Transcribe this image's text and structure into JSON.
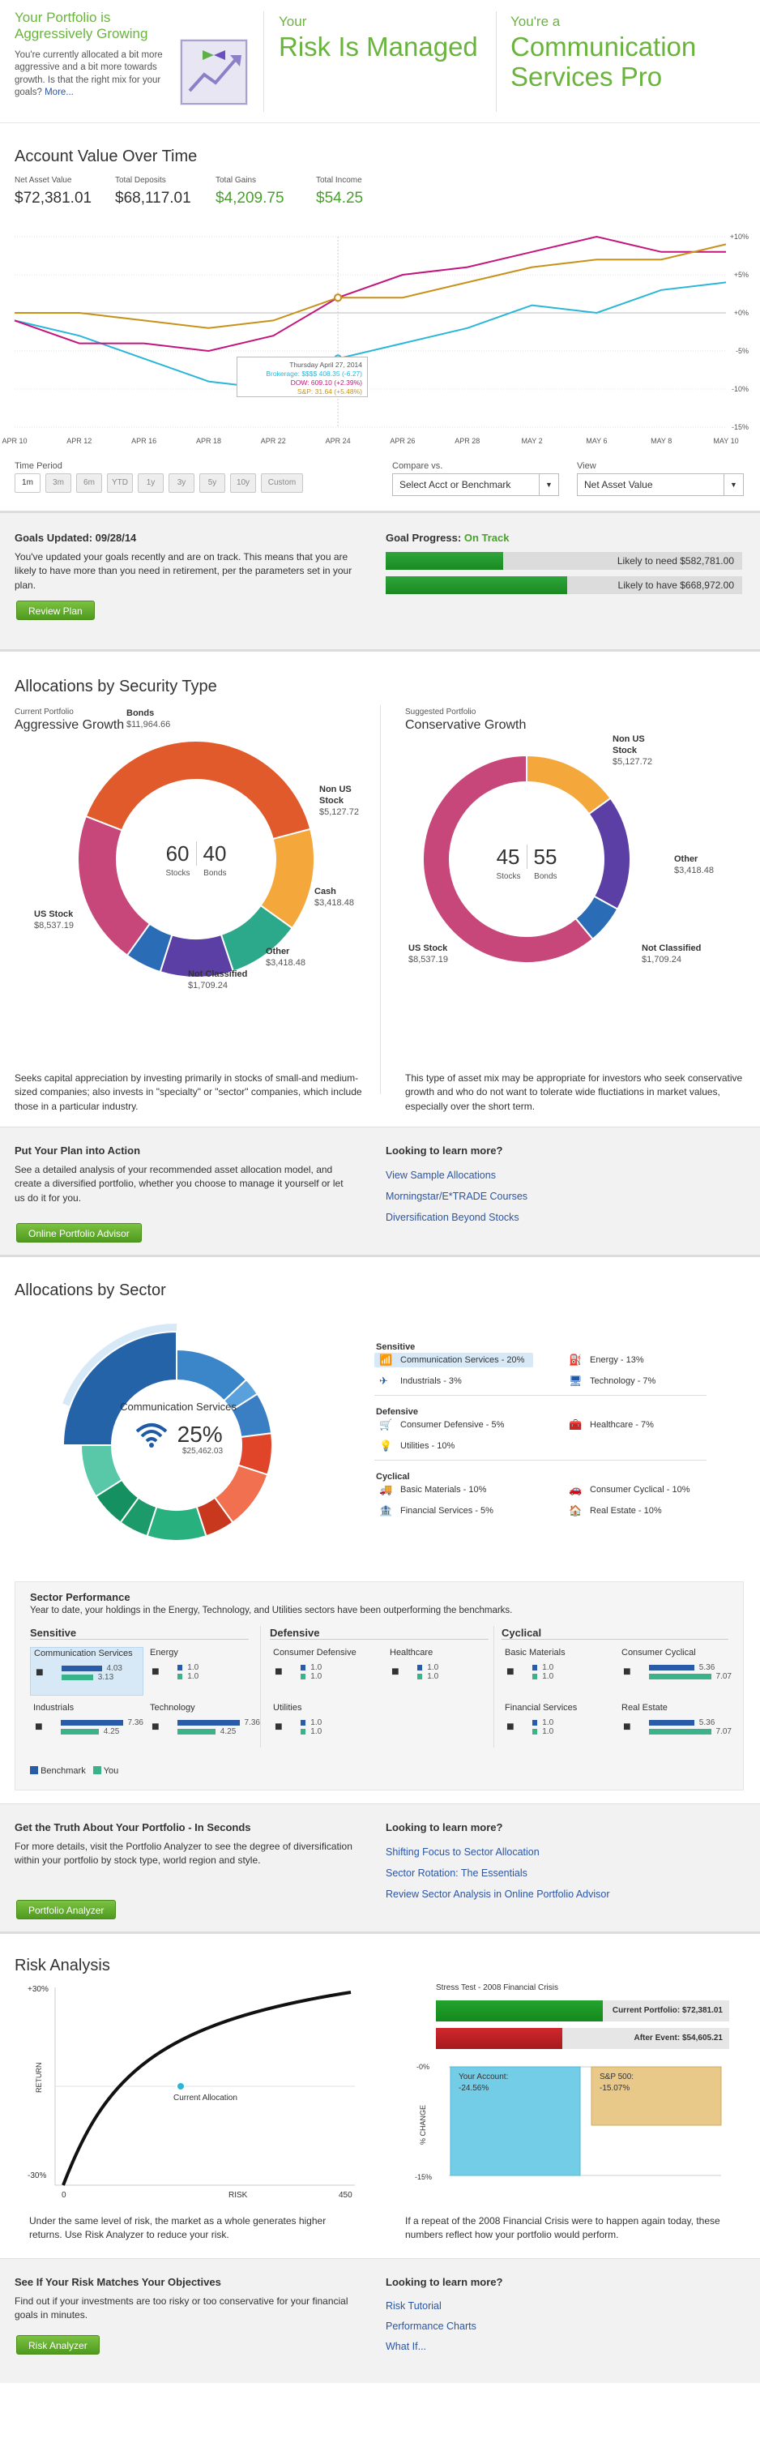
{
  "hero": {
    "c1_title": "Your Portfolio is Aggressively Growing",
    "c1_text": "You're currently allocated a bit more aggressive and a bit more towards growth. Is that the right mix for your goals?",
    "c1_more": "More...",
    "c2_label": "Your",
    "c2_big": "Risk Is Managed",
    "c3_label": "You're a",
    "c3_big": "Communication Services Pro"
  },
  "account": {
    "title": "Account Value Over Time",
    "stats": [
      {
        "label": "Net Asset Value",
        "value": "$72,381.01"
      },
      {
        "label": "Total Deposits",
        "value": "$68,117.01"
      },
      {
        "label": "Total Gains",
        "value": "$4,209.75"
      },
      {
        "label": "Total Income",
        "value": "$54.25"
      }
    ],
    "time_period_label": "Time Period",
    "time_buttons": [
      "1m",
      "3m",
      "6m",
      "YTD",
      "1y",
      "3y",
      "5y",
      "10y",
      "Custom"
    ],
    "compare_label": "Compare vs.",
    "compare_value": "Select Acct or Benchmark",
    "view_label": "View",
    "view_value": "Net Asset Value"
  },
  "chart_data": {
    "type": "line",
    "x": [
      "APR 10",
      "APR 12",
      "APR 16",
      "APR 18",
      "APR 22",
      "APR 24",
      "APR 26",
      "APR 28",
      "MAY 2",
      "MAY 6",
      "MAY 8",
      "MAY 10"
    ],
    "ylim": [
      -15,
      10
    ],
    "y_ticks": [
      "+10%",
      "+5%",
      "+0%",
      "-5%",
      "-10%",
      "-15%"
    ],
    "series": [
      {
        "name": "Brokerage",
        "color": "#29b6d8",
        "values": [
          -1,
          -3,
          -6,
          -9,
          -10,
          -6,
          -4,
          -2,
          1,
          0,
          3,
          4
        ]
      },
      {
        "name": "DOW",
        "color": "#c2167d",
        "values": [
          -1,
          -4,
          -4,
          -5,
          -3,
          2,
          5,
          6,
          8,
          10,
          8,
          8
        ]
      },
      {
        "name": "S&P",
        "color": "#c8921a",
        "values": [
          0,
          0,
          -1,
          -2,
          -1,
          2,
          2,
          4,
          6,
          7,
          7,
          9
        ]
      }
    ],
    "tooltip": {
      "date": "Thursday April 27, 2014",
      "rows": [
        {
          "name": "Brokerage",
          "text": "Brokerage: $$$$ 408.35 (-6.27)"
        },
        {
          "name": "DOW",
          "text": "DOW: 609.10 (+2.39%)"
        },
        {
          "name": "S&P",
          "text": "S&P: 31.64 (+5.48%)"
        }
      ]
    }
  },
  "goals": {
    "title": "Goals Updated: 09/28/14",
    "text": "You've updated your goals recently and are on track. This means that you are likely to have more than you need in retirement, per the parameters set in your plan.",
    "button": "Review Plan",
    "progress_label": "Goal Progress:",
    "progress_status": "On Track",
    "bars": [
      {
        "text": "Likely to need $582,781.00",
        "fraction": 0.33
      },
      {
        "text": "Likely to have $668,972.00",
        "fraction": 0.51
      }
    ]
  },
  "alloc": {
    "title": "Allocations by Security Type",
    "current_small": "Current Portfolio",
    "current_name": "Aggressive Growth",
    "current_center": {
      "stocks": "60",
      "bonds": "40",
      "stocks_lbl": "Stocks",
      "bonds_lbl": "Bonds"
    },
    "current_segments": [
      {
        "name": "Bonds",
        "value": "$11,964.66",
        "color": "#e05a2b",
        "share": 0.4
      },
      {
        "name": "Non US Stock",
        "value": "$5,127.72",
        "color": "#f4a73a",
        "share": 0.14
      },
      {
        "name": "Cash",
        "value": "$3,418.48",
        "color": "#2ba98a",
        "share": 0.1
      },
      {
        "name": "Other",
        "value": "$3,418.48",
        "color": "#5b3fa5",
        "share": 0.1
      },
      {
        "name": "Not Classified",
        "value": "$1,709.24",
        "color": "#2a6cb5",
        "share": 0.05
      },
      {
        "name": "US Stock",
        "value": "$8,537.19",
        "color": "#c8477a",
        "share": 0.21
      }
    ],
    "current_text": "Seeks capital appreciation by investing primarily in stocks of small-and medium-sized companies; also invests in \"specialty\" or \"sector\" companies, which include those in a particular industry.",
    "suggested_small": "Suggested Portfolio",
    "suggested_name": "Conservative Growth",
    "suggested_center": {
      "stocks": "45",
      "bonds": "55",
      "stocks_lbl": "Stocks",
      "bonds_lbl": "Bonds"
    },
    "suggested_segments": [
      {
        "name": "Non US Stock",
        "value": "$5,127.72",
        "color": "#f4a73a",
        "share": 0.15
      },
      {
        "name": "Other",
        "value": "$3,418.48",
        "color": "#5b3fa5",
        "share": 0.18
      },
      {
        "name": "Not Classified",
        "value": "$1,709.24",
        "color": "#2a6cb5",
        "share": 0.06
      },
      {
        "name": "US Stock",
        "value": "$8,537.19",
        "color": "#c8477a",
        "share": 0.61
      }
    ],
    "suggested_text": "This type of asset mix may be appropriate for investors who seek conservative growth and who do not want to tolerate wide fluctiations in market values, especially over the short term."
  },
  "plan": {
    "title": "Put Your Plan into Action",
    "text": "See a detailed analysis of your recommended asset allocation model, and create a diversified portfolio, whether you choose to manage it yourself or let us do it for you.",
    "button": "Online Portfolio Advisor",
    "learn_title": "Looking to learn more?",
    "links": [
      "View Sample Allocations",
      "Morningstar/E*TRADE Courses",
      "Diversification Beyond Stocks"
    ]
  },
  "sector": {
    "title": "Allocations by Sector",
    "center_name": "Communication Services",
    "center_pct": "25%",
    "center_value": "$25,462.03",
    "ring": [
      {
        "color": "#2563a8",
        "share": 0.25
      },
      {
        "color": "#3a86c8",
        "share": 0.13
      },
      {
        "color": "#5aa0dc",
        "share": 0.03
      },
      {
        "color": "#3a7ec4",
        "share": 0.07
      },
      {
        "color": "#e0452a",
        "share": 0.07
      },
      {
        "color": "#f07050",
        "share": 0.1
      },
      {
        "color": "#c8381e",
        "share": 0.05
      },
      {
        "color": "#28b07e",
        "share": 0.1
      },
      {
        "color": "#1c9a6a",
        "share": 0.05
      },
      {
        "color": "#159060",
        "share": 0.06
      },
      {
        "color": "#58c8a8",
        "share": 0.09
      }
    ],
    "groups": [
      {
        "name": "Sensitive",
        "items": [
          "Communication Services - 20%",
          "Energy - 13%",
          "Industrials - 3%",
          "Technology - 7%"
        ]
      },
      {
        "name": "Defensive",
        "items": [
          "Consumer Defensive - 5%",
          "Healthcare - 7%",
          "Utilities - 10%"
        ]
      },
      {
        "name": "Cyclical",
        "items": [
          "Basic Materials - 10%",
          "Consumer Cyclical - 10%",
          "Financial Services - 5%",
          "Real Estate - 10%"
        ]
      }
    ]
  },
  "performance": {
    "title": "Sector Performance",
    "subtitle": "Year to date, your holdings in the Energy, Technology, and Utilities sectors have been outperforming the benchmarks.",
    "groups": [
      "Sensitive",
      "Defensive",
      "Cyclical"
    ],
    "cards": [
      {
        "name": "Communication Services",
        "b": "4.03",
        "y": "3.13",
        "bf": 0.55,
        "yf": 0.43
      },
      {
        "name": "Energy",
        "b": "1.0",
        "y": "1.0",
        "bf": 0.07,
        "yf": 0.07
      },
      {
        "name": "Industrials",
        "b": "7.36",
        "y": "4.25",
        "bf": 0.85,
        "yf": 0.52
      },
      {
        "name": "Technology",
        "b": "7.36",
        "y": "4.25",
        "bf": 0.85,
        "yf": 0.52
      },
      {
        "name": "Consumer Defensive",
        "b": "1.0",
        "y": "1.0",
        "bf": 0.07,
        "yf": 0.07
      },
      {
        "name": "Healthcare",
        "b": "1.0",
        "y": "1.0",
        "bf": 0.07,
        "yf": 0.07
      },
      {
        "name": "Utilities",
        "b": "1.0",
        "y": "1.0",
        "bf": 0.07,
        "yf": 0.07
      },
      {
        "name": "Basic Materials",
        "b": "1.0",
        "y": "1.0",
        "bf": 0.07,
        "yf": 0.07
      },
      {
        "name": "Consumer Cyclical",
        "b": "5.36",
        "y": "7.07",
        "bf": 0.62,
        "yf": 0.85
      },
      {
        "name": "Financial Services",
        "b": "1.0",
        "y": "1.0",
        "bf": 0.07,
        "yf": 0.07
      },
      {
        "name": "Real Estate",
        "b": "5.36",
        "y": "7.07",
        "bf": 0.62,
        "yf": 0.85
      }
    ],
    "legend_bench": "Benchmark",
    "legend_you": "You"
  },
  "truth": {
    "title": "Get the Truth About Your Portfolio - In Seconds",
    "text": "For more details, visit the Portfolio Analyzer to see the degree of diversification within your portfolio by stock type, world region and style.",
    "button": "Portfolio Analyzer",
    "learn_title": "Looking to learn more?",
    "links": [
      "Shifting Focus to Sector Allocation",
      "Sector Rotation: The Essentials",
      "Review Sector Analysis in Online Portfolio Advisor"
    ]
  },
  "risk": {
    "title": "Risk Analysis",
    "y_top": "+30%",
    "y_bottom": "-30%",
    "y_label": "RETURN",
    "x_left": "0",
    "x_mid": "RISK",
    "x_right": "450",
    "point_label": "Current Allocation",
    "left_text": "Under the same level of risk, the market as a whole generates higher returns. Use Risk Analyzer to reduce your risk.",
    "stress_title": "Stress Test - 2008 Financial Crisis",
    "current_label": "Current Portfolio: $72,381.01",
    "after_label": "After Event: $54,605.21",
    "pct_top": "-0%",
    "pct_bottom": "-15%",
    "pct_axis": "% CHANGE",
    "account_label": "Your Account:",
    "account_value": "-24.56%",
    "sp_label": "S&P 500:",
    "sp_value": "-15.07%",
    "right_text": "If a repeat of the 2008 Financial Crisis were to happen again today, these numbers reflect how your portfolio would perform."
  },
  "objectives": {
    "title": "See If Your Risk Matches Your Objectives",
    "text": "Find out if your investments are too risky or too conservative for your financial goals in minutes.",
    "button": "Risk Analyzer",
    "learn_title": "Looking to learn more?",
    "links": [
      "Risk Tutorial",
      "Performance Charts",
      "What If..."
    ]
  }
}
